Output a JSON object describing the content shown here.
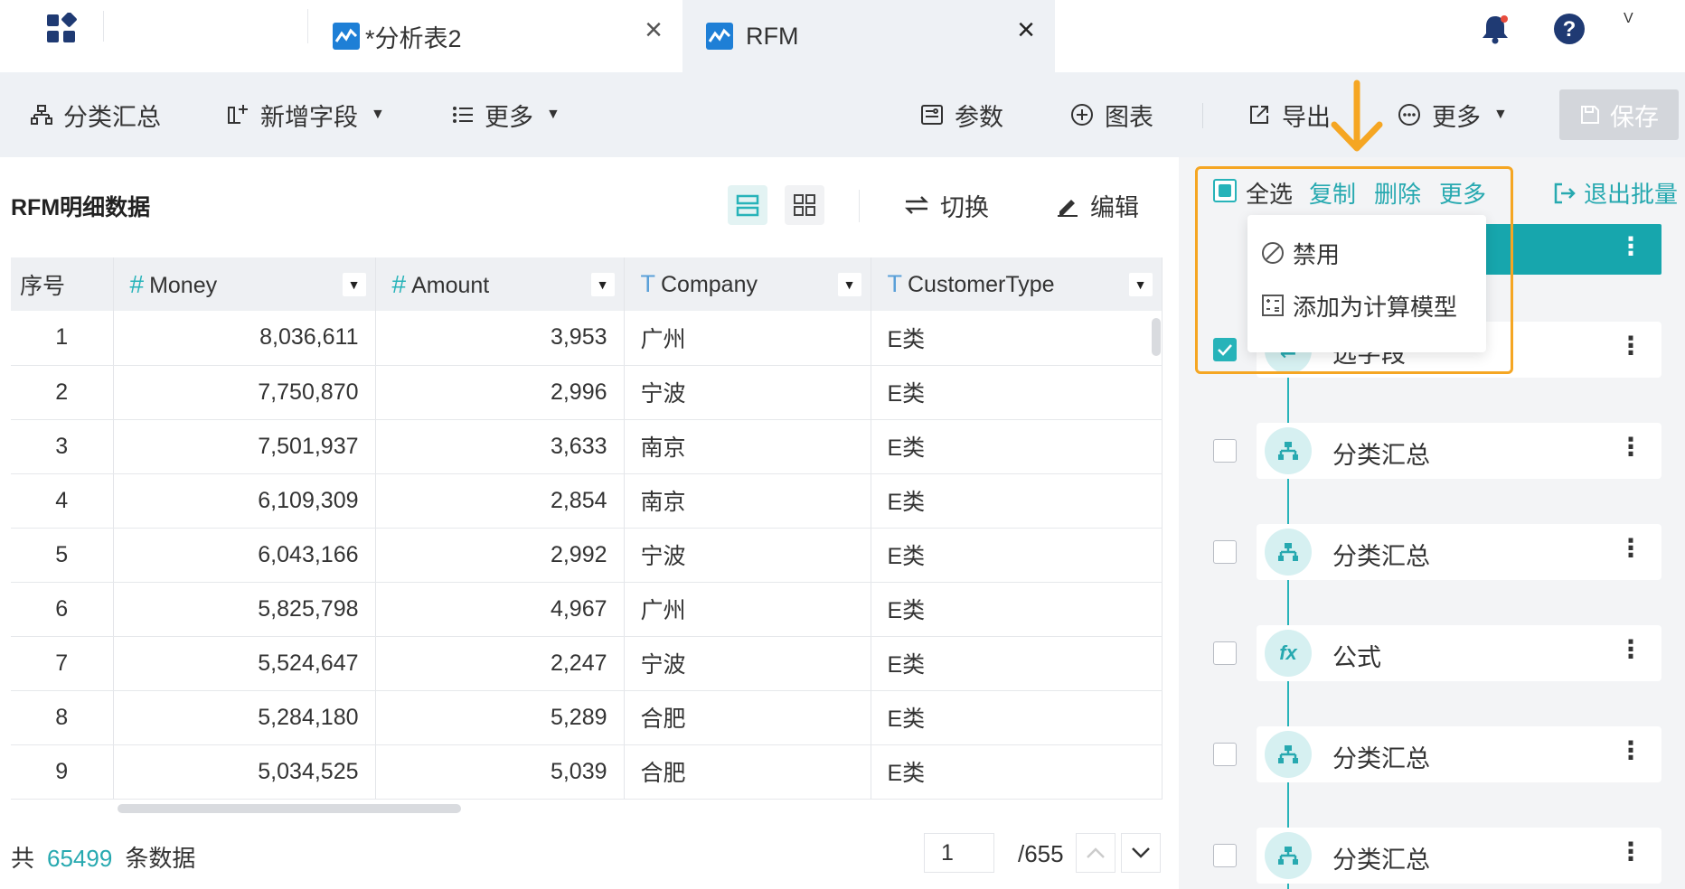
{
  "tabs": [
    {
      "label": "*分析表2",
      "close": "×"
    },
    {
      "label": "RFM",
      "close": "×"
    }
  ],
  "header": {
    "avatar": "V"
  },
  "toolbar": {
    "group": "分类汇总",
    "add_field": "新增字段",
    "more_left": "更多",
    "params": "参数",
    "chart": "图表",
    "export": "导出",
    "more_right": "更多",
    "save": "保存"
  },
  "panel": {
    "title": "RFM明细数据",
    "switch": "切换",
    "edit": "编辑"
  },
  "table": {
    "columns": [
      {
        "label": "序号",
        "type": ""
      },
      {
        "label": "Money",
        "type": "#"
      },
      {
        "label": "Amount",
        "type": "#"
      },
      {
        "label": "Company",
        "type": "T"
      },
      {
        "label": "CustomerType",
        "type": "T"
      }
    ],
    "rows": [
      [
        "1",
        "8,036,611",
        "3,953",
        "广州",
        "E类"
      ],
      [
        "2",
        "7,750,870",
        "2,996",
        "宁波",
        "E类"
      ],
      [
        "3",
        "7,501,937",
        "3,633",
        "南京",
        "E类"
      ],
      [
        "4",
        "6,109,309",
        "2,854",
        "南京",
        "E类"
      ],
      [
        "5",
        "6,043,166",
        "2,992",
        "宁波",
        "E类"
      ],
      [
        "6",
        "5,825,798",
        "4,967",
        "广州",
        "E类"
      ],
      [
        "7",
        "5,524,647",
        "2,247",
        "宁波",
        "E类"
      ],
      [
        "8",
        "5,284,180",
        "5,289",
        "合肥",
        "E类"
      ],
      [
        "9",
        "5,034,525",
        "5,039",
        "合肥",
        "E类"
      ]
    ]
  },
  "footer": {
    "prefix": "共",
    "count": "65499",
    "suffix": "条数据",
    "page": "1",
    "total_pages": "/655"
  },
  "batch": {
    "select_all": "全选",
    "copy": "复制",
    "delete": "删除",
    "more": "更多",
    "exit": "退出批量"
  },
  "dropdown": {
    "items": [
      "禁用",
      "添加为计算模型"
    ]
  },
  "steps": [
    {
      "label": "选字段",
      "checked": true
    },
    {
      "label": "分类汇总",
      "checked": false
    },
    {
      "label": "分类汇总",
      "checked": false
    },
    {
      "label": "公式",
      "checked": false
    },
    {
      "label": "分类汇总",
      "checked": false
    },
    {
      "label": "分类汇总",
      "checked": false
    }
  ],
  "colors": {
    "accent": "#27b3b9",
    "highlight": "#f5a623",
    "avatar": "#f47c3c"
  }
}
